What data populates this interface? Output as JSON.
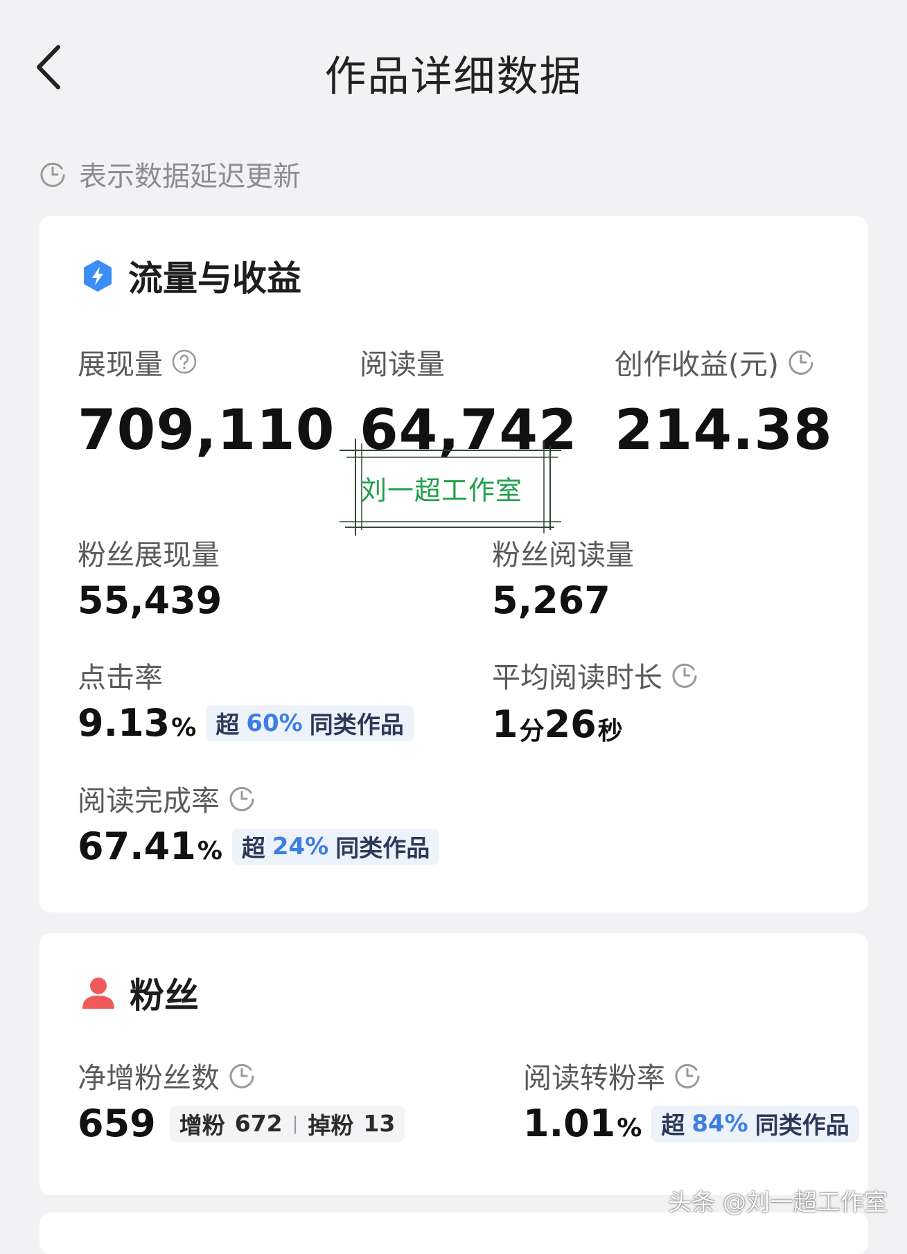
{
  "header": {
    "title": "作品详细数据",
    "back_icon": "chevron-left-icon"
  },
  "notice": {
    "text": "表示数据延迟更新",
    "icon": "clock-icon"
  },
  "traffic": {
    "title": "流量与收益",
    "icon": "lightning-icon",
    "icon_color": "#3c8ef5",
    "impressions": {
      "label": "展现量",
      "value": "709,110",
      "icon": "question-icon"
    },
    "reads": {
      "label": "阅读量",
      "value": "64,742"
    },
    "earnings": {
      "label": "创作收益(元)",
      "value": "214.38",
      "icon": "clock-icon"
    },
    "fan_impressions": {
      "label": "粉丝展现量",
      "value": "55,439"
    },
    "fan_reads": {
      "label": "粉丝阅读量",
      "value": "5,267"
    },
    "ctr": {
      "label": "点击率",
      "value": "9.13",
      "unit": "%",
      "tag_prefix": "超",
      "tag_pct": "60%",
      "tag_suffix": "同类作品"
    },
    "avg_read_time": {
      "label": "平均阅读时长",
      "minutes": "1",
      "min_unit": "分",
      "seconds": "26",
      "sec_unit": "秒",
      "icon": "clock-icon"
    },
    "completion": {
      "label": "阅读完成率",
      "value": "67.41",
      "unit": "%",
      "tag_prefix": "超",
      "tag_pct": "24%",
      "tag_suffix": "同类作品",
      "icon": "clock-icon"
    }
  },
  "fans": {
    "title": "粉丝",
    "icon": "person-icon",
    "icon_color": "#f05a5a",
    "net_gain": {
      "label": "净增粉丝数",
      "value": "659",
      "gain_label": "增粉",
      "gain_value": "672",
      "loss_label": "掉粉",
      "loss_value": "13",
      "icon": "clock-icon"
    },
    "conversion": {
      "label": "阅读转粉率",
      "value": "1.01",
      "unit": "%",
      "tag_prefix": "超",
      "tag_pct": "84%",
      "tag_suffix": "同类作品",
      "icon": "clock-icon"
    }
  },
  "stamp": {
    "text": "刘一超工作室",
    "color": "#1fa04a"
  },
  "watermark": {
    "text": "头条 @刘一超工作室"
  }
}
